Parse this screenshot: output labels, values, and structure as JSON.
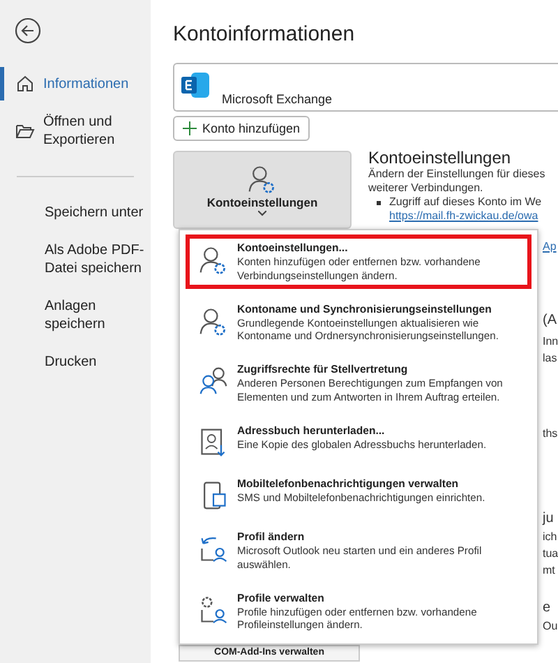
{
  "sidebar": {
    "items": [
      {
        "label": "Informationen",
        "selected": true
      },
      {
        "label": "Öffnen und Exportieren",
        "selected": false
      },
      {
        "label": "Speichern unter",
        "selected": false
      },
      {
        "label": "Als Adobe PDF-Datei speichern",
        "selected": false
      },
      {
        "label": "Anlagen speichern",
        "selected": false
      },
      {
        "label": "Drucken",
        "selected": false
      }
    ]
  },
  "title": "Kontoinformationen",
  "account": {
    "name": "Microsoft Exchange"
  },
  "add_account_button": "Konto hinzufügen",
  "account_settings_button": {
    "label": "Kontoeinstellungen",
    "expanded": true
  },
  "account_settings": {
    "heading": "Kontoeinstellungen",
    "description_lines": [
      "Ändern der Einstellungen für dieses",
      "weiterer Verbindungen."
    ],
    "bullet": "Zugriff auf dieses Konto im We",
    "link": "https://mail.fh-zwickau.de/owa",
    "link_2": "Ap"
  },
  "menu": [
    {
      "title": "Kontoeinstellungen...",
      "description": "Konten hinzufügen oder entfernen bzw. vorhandene Verbindungseinstellungen ändern.",
      "selected": true
    },
    {
      "title": "Kontoname und Synchronisierungseinstellungen",
      "description": "Grundlegende Kontoeinstellungen aktualisieren wie Kontoname und Ordnersynchronisierungseinstellungen.",
      "selected": false
    },
    {
      "title": "Zugriffsrechte für Stellvertretung",
      "description": "Anderen Personen Berechtigungen zum Empfangen von Elementen und zum Antworten in Ihrem Auftrag erteilen.",
      "selected": false
    },
    {
      "title": "Adressbuch herunterladen...",
      "description": "Eine Kopie des globalen Adressbuchs herunterladen.",
      "selected": false
    },
    {
      "title": "Mobiltelefonbenachrichtigungen verwalten",
      "description": "SMS und Mobiltelefonbenachrichtigungen einrichten.",
      "selected": false
    },
    {
      "title": "Profil ändern",
      "description": "Microsoft Outlook neu starten und ein anderes Profil auswählen.",
      "selected": false
    },
    {
      "title": "Profile verwalten",
      "description": "Profile hinzufügen oder entfernen bzw. vorhandene Profileinstellungen ändern.",
      "selected": false
    }
  ],
  "background_fragments": [
    "(A",
    "Inn",
    "las",
    "ths",
    "ju",
    "ich",
    "tua",
    "mt",
    "e",
    "Ou"
  ],
  "com_button": "COM-Add-Ins verwalten"
}
